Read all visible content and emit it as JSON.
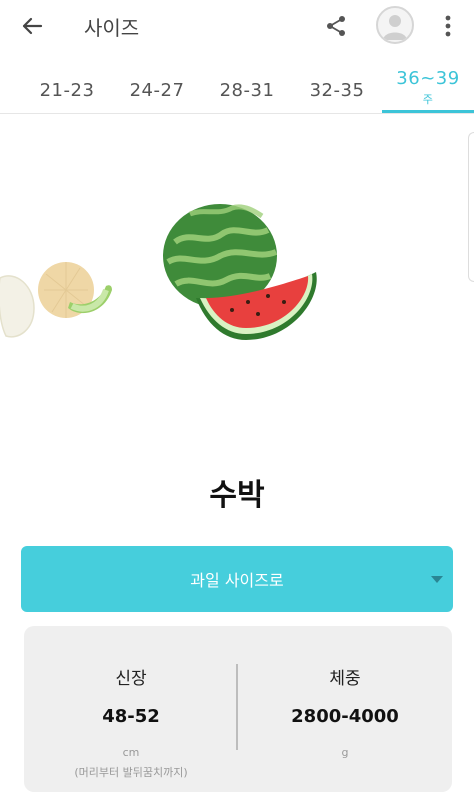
{
  "appbar": {
    "title": "사이즈",
    "icons": {
      "back": "arrow-left-icon",
      "share": "share-icon",
      "avatar": "user-avatar-icon",
      "more": "more-vertical-icon"
    }
  },
  "tabs": {
    "items": [
      {
        "label": "21-23"
      },
      {
        "label": "24-27"
      },
      {
        "label": "28-31"
      },
      {
        "label": "32-35"
      },
      {
        "label": "36~39",
        "sub": "주"
      }
    ],
    "active_index": 4
  },
  "fruit": {
    "name": "수박"
  },
  "dropdown": {
    "label": "과일 사이즈로"
  },
  "stats": {
    "height": {
      "label": "신장",
      "value": "48-52",
      "unit": "cm",
      "note": "(머리부터 발뒤꿈치까지)"
    },
    "weight": {
      "label": "체중",
      "value": "2800-4000",
      "unit": "g"
    }
  },
  "colors": {
    "accent": "#3cc4d8",
    "dropdown_bg": "#46cedc",
    "stats_bg": "#efefef"
  }
}
